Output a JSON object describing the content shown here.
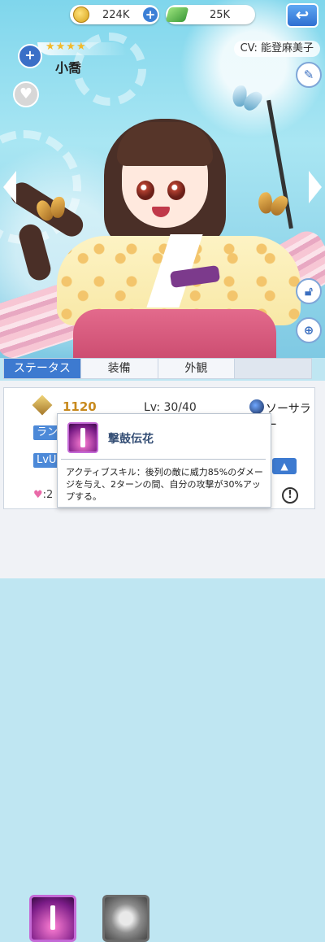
{
  "currency": {
    "gold": "224K",
    "gems": "25K"
  },
  "character": {
    "stars": "★★★★",
    "name": "小喬",
    "cv": "CV: 能登麻美子"
  },
  "tabs": [
    "ステータス",
    "装備",
    "外観"
  ],
  "status": {
    "power": "1120",
    "level": "Lv: 30/40",
    "job": "ソーサラー",
    "rank_tag": "ラン",
    "lvup_tag": "LvU",
    "heart_value": "2"
  },
  "skill_tooltip": {
    "title": "撃鼓伝花",
    "description": "アクティブスキル：後列の敵に威力85%のダメージを与え、2ターンの間、自分の攻撃が30%アップする。"
  },
  "skills": [
    {
      "icon": "sword-skill-icon"
    },
    {
      "icon": "burst-skill-icon"
    }
  ],
  "colors": {
    "accent": "#3d7ad0",
    "power": "#c88a1e"
  }
}
